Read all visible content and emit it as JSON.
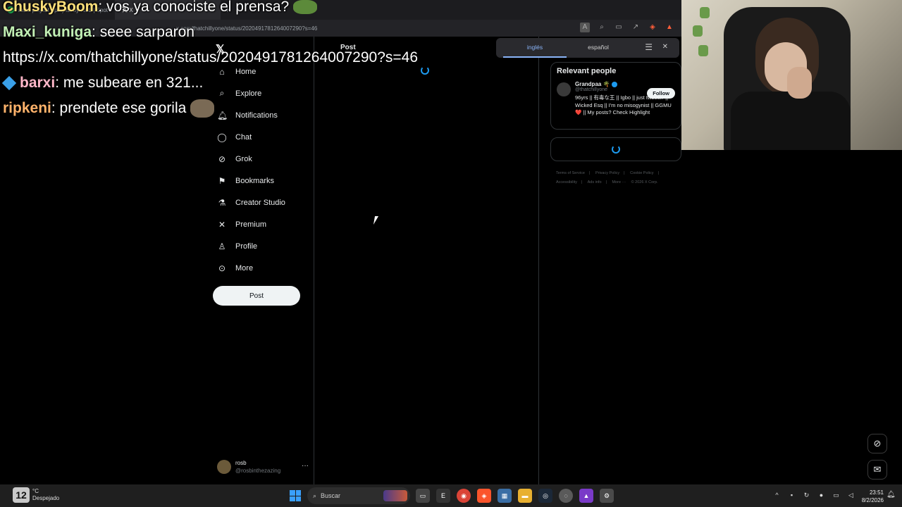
{
  "browser": {
    "tabs": [
      {
        "label": "rosbi playlist - playlist by rosb | Spot"
      },
      {
        "label": "X"
      }
    ],
    "new_tab": "+",
    "url": "x.com/thatchillyone/status/2020491781264007290?s=46"
  },
  "translate_popup": {
    "source_lang": "inglés",
    "target_lang": "español",
    "menu_icon": "menu-icon",
    "close_icon": "close-icon"
  },
  "x_sidebar": {
    "logo": "𝕏",
    "nav": [
      {
        "label": "Home",
        "icon": "home-icon"
      },
      {
        "label": "Explore",
        "icon": "search-icon"
      },
      {
        "label": "Notifications",
        "icon": "bell-icon"
      },
      {
        "label": "Chat",
        "icon": "chat-icon"
      },
      {
        "label": "Grok",
        "icon": "grok-icon"
      },
      {
        "label": "Bookmarks",
        "icon": "bookmark-icon"
      },
      {
        "label": "Creator Studio",
        "icon": "flask-icon"
      },
      {
        "label": "Premium",
        "icon": "x-icon"
      },
      {
        "label": "Profile",
        "icon": "person-icon"
      },
      {
        "label": "More",
        "icon": "more-circle-icon"
      }
    ],
    "post_button": "Post",
    "account": {
      "name": "rosb",
      "handle": "@rosbinthezazing",
      "more": "···"
    }
  },
  "main": {
    "header": "Post"
  },
  "right_column": {
    "relevant_title": "Relevant people",
    "person": {
      "name": "Grandpaa 🌴",
      "handle": "@thatchillyone",
      "bio": "96yrs || 有毒な王 || Igbo || just tweetin' || Wicked Esq || I'm no misogynist || GGMU ❤️ || My posts? Check Highlight",
      "follow_label": "Follow"
    },
    "footer_links": [
      "Terms of Service",
      "|",
      "Privacy Policy",
      "|",
      "Cookie Policy",
      "|",
      "Accessibility",
      "|",
      "Ads info",
      "|",
      "More ···",
      "© 2026 X Corp."
    ]
  },
  "chat": {
    "partial_top": {
      "user": "ChuskyBoom",
      "message": ": vos ya conociste el prensa?"
    },
    "messages": [
      {
        "user": "Maxi_kuniga",
        "message": ": seee sarparon"
      },
      {
        "user": "barxi",
        "message": ": me subeare en 321..."
      },
      {
        "user": "ripkeni",
        "message": ": prendete ese gorila"
      }
    ],
    "url_text": "https://x.com/thatchillyone/status/2020491781264007290?s=46"
  },
  "taskbar": {
    "weather_temp": "12",
    "weather_text_line1": "°C",
    "weather_text_line2": "Despejado",
    "search_label": "Buscar",
    "time": "23:51",
    "date": "8/2/2026"
  },
  "colors": {
    "accent": "#1d9bf0",
    "background": "#000000",
    "brave": "#ff5e3a"
  }
}
